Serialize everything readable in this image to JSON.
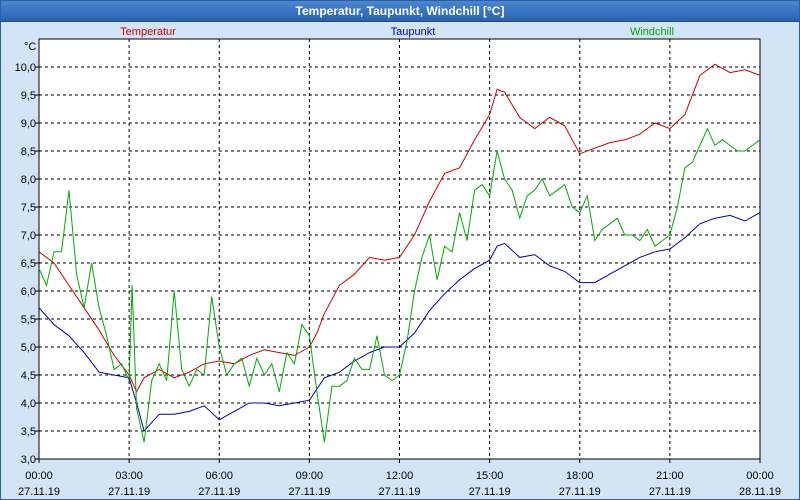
{
  "window": {
    "title": "Temperatur, Taupunkt, Windchill [°C]"
  },
  "chart_data": {
    "type": "line",
    "ylabel": "°C",
    "ylim": [
      3.0,
      10.25
    ],
    "yticks": [
      "3,0",
      "3,5",
      "4,0",
      "4,5",
      "5,0",
      "5,5",
      "6,0",
      "6,5",
      "7,0",
      "7,5",
      "8,0",
      "8,5",
      "9,0",
      "9,5",
      "10,0"
    ],
    "xlim": [
      0,
      24
    ],
    "xticks": [
      {
        "time": "00:00",
        "date": "27.11.19"
      },
      {
        "time": "03:00",
        "date": "27.11.19"
      },
      {
        "time": "06:00",
        "date": "27.11.19"
      },
      {
        "time": "09:00",
        "date": "27.11.19"
      },
      {
        "time": "12:00",
        "date": "27.11.19"
      },
      {
        "time": "15:00",
        "date": "27.11.19"
      },
      {
        "time": "18:00",
        "date": "27.11.19"
      },
      {
        "time": "21:00",
        "date": "27.11.19"
      },
      {
        "time": "00:00",
        "date": "28.11.19"
      }
    ],
    "grid": true,
    "legend_position": "top",
    "series": [
      {
        "name": "Temperatur",
        "color": "#cc0000",
        "x": [
          0,
          0.5,
          1,
          1.5,
          2,
          2.5,
          3,
          3.25,
          3.5,
          4,
          4.5,
          5,
          5.5,
          6,
          6.5,
          7,
          7.5,
          8,
          8.5,
          9,
          9.25,
          9.5,
          10,
          10.5,
          11,
          11.5,
          12,
          12.5,
          13,
          13.5,
          14,
          14.5,
          15,
          15.25,
          15.5,
          16,
          16.5,
          17,
          17.5,
          18,
          18.5,
          19,
          19.5,
          20,
          20.5,
          21,
          21.5,
          22,
          22.5,
          23,
          23.5,
          24
        ],
        "values": [
          6.7,
          6.5,
          6.1,
          5.7,
          5.3,
          4.85,
          4.5,
          4.2,
          4.45,
          4.6,
          4.45,
          4.55,
          4.7,
          4.75,
          4.7,
          4.85,
          4.95,
          4.9,
          4.85,
          5.0,
          5.25,
          5.6,
          6.1,
          6.3,
          6.6,
          6.55,
          6.6,
          7.0,
          7.6,
          8.1,
          8.2,
          8.7,
          9.15,
          9.6,
          9.55,
          9.1,
          8.9,
          9.1,
          8.95,
          8.45,
          8.55,
          8.65,
          8.7,
          8.8,
          9.0,
          8.9,
          9.15,
          9.85,
          10.05,
          9.9,
          9.95,
          9.85
        ]
      },
      {
        "name": "Taupunkt",
        "color": "#0000aa",
        "x": [
          0,
          0.5,
          1,
          1.5,
          2,
          2.5,
          3,
          3.25,
          3.5,
          4,
          4.5,
          5,
          5.5,
          6,
          6.5,
          7,
          7.5,
          8,
          8.5,
          9,
          9.25,
          9.5,
          10,
          10.5,
          11,
          11.5,
          12,
          12.5,
          13,
          13.5,
          14,
          14.5,
          15,
          15.25,
          15.5,
          16,
          16.5,
          17,
          17.5,
          18,
          18.5,
          19,
          19.5,
          20,
          20.5,
          21,
          21.5,
          22,
          22.5,
          23,
          23.5,
          24
        ],
        "values": [
          5.7,
          5.4,
          5.2,
          4.9,
          4.55,
          4.5,
          4.45,
          4.0,
          3.5,
          3.8,
          3.8,
          3.85,
          3.95,
          3.7,
          3.85,
          4.0,
          4.0,
          3.95,
          4.0,
          4.05,
          4.25,
          4.45,
          4.55,
          4.75,
          4.9,
          5.0,
          5.0,
          5.25,
          5.65,
          5.95,
          6.2,
          6.4,
          6.55,
          6.8,
          6.85,
          6.6,
          6.65,
          6.45,
          6.35,
          6.15,
          6.15,
          6.3,
          6.45,
          6.6,
          6.7,
          6.75,
          6.95,
          7.2,
          7.3,
          7.35,
          7.25,
          7.4
        ]
      },
      {
        "name": "Windchill",
        "color": "#00aa00",
        "x": [
          0,
          0.25,
          0.5,
          0.75,
          1,
          1.25,
          1.5,
          1.75,
          2,
          2.25,
          2.5,
          2.75,
          3,
          3.1,
          3.25,
          3.5,
          3.75,
          4,
          4.25,
          4.5,
          4.75,
          5,
          5.25,
          5.5,
          5.75,
          6,
          6.25,
          6.5,
          6.75,
          7,
          7.25,
          7.5,
          7.75,
          8,
          8.25,
          8.5,
          8.75,
          9,
          9.25,
          9.5,
          9.75,
          10,
          10.25,
          10.5,
          10.75,
          11,
          11.25,
          11.5,
          11.75,
          12,
          12.25,
          12.5,
          12.75,
          13,
          13.25,
          13.5,
          13.75,
          14,
          14.25,
          14.5,
          14.75,
          15,
          15.25,
          15.5,
          15.75,
          16,
          16.25,
          16.5,
          16.75,
          17,
          17.25,
          17.5,
          17.75,
          18,
          18.25,
          18.5,
          18.75,
          19,
          19.25,
          19.5,
          19.75,
          20,
          20.25,
          20.5,
          20.75,
          21,
          21.25,
          21.5,
          21.75,
          22,
          22.25,
          22.5,
          22.75,
          23,
          23.25,
          23.5,
          23.75,
          24
        ],
        "values": [
          6.4,
          6.1,
          6.7,
          6.7,
          7.8,
          6.3,
          5.7,
          6.5,
          5.7,
          5.2,
          4.6,
          4.7,
          4.4,
          6.1,
          3.9,
          3.3,
          4.4,
          4.7,
          4.4,
          6.0,
          4.6,
          4.3,
          4.6,
          4.5,
          5.9,
          5.0,
          4.5,
          4.7,
          4.8,
          4.3,
          4.8,
          4.5,
          4.7,
          4.2,
          4.9,
          4.7,
          5.4,
          5.2,
          4.2,
          3.3,
          4.3,
          4.3,
          4.4,
          4.8,
          4.6,
          4.6,
          5.2,
          4.5,
          4.4,
          4.5,
          5.1,
          6.0,
          6.6,
          7.0,
          6.2,
          6.8,
          6.7,
          7.4,
          6.9,
          7.8,
          7.9,
          7.7,
          8.5,
          8.0,
          7.8,
          7.3,
          7.7,
          7.8,
          8.0,
          7.7,
          7.8,
          7.9,
          7.5,
          7.4,
          7.7,
          6.9,
          7.1,
          7.2,
          7.3,
          7.0,
          7.0,
          6.9,
          7.1,
          6.8,
          6.9,
          7.0,
          7.5,
          8.2,
          8.3,
          8.6,
          8.9,
          8.6,
          8.7,
          8.6,
          8.5,
          8.5,
          8.6,
          8.7
        ]
      }
    ]
  }
}
